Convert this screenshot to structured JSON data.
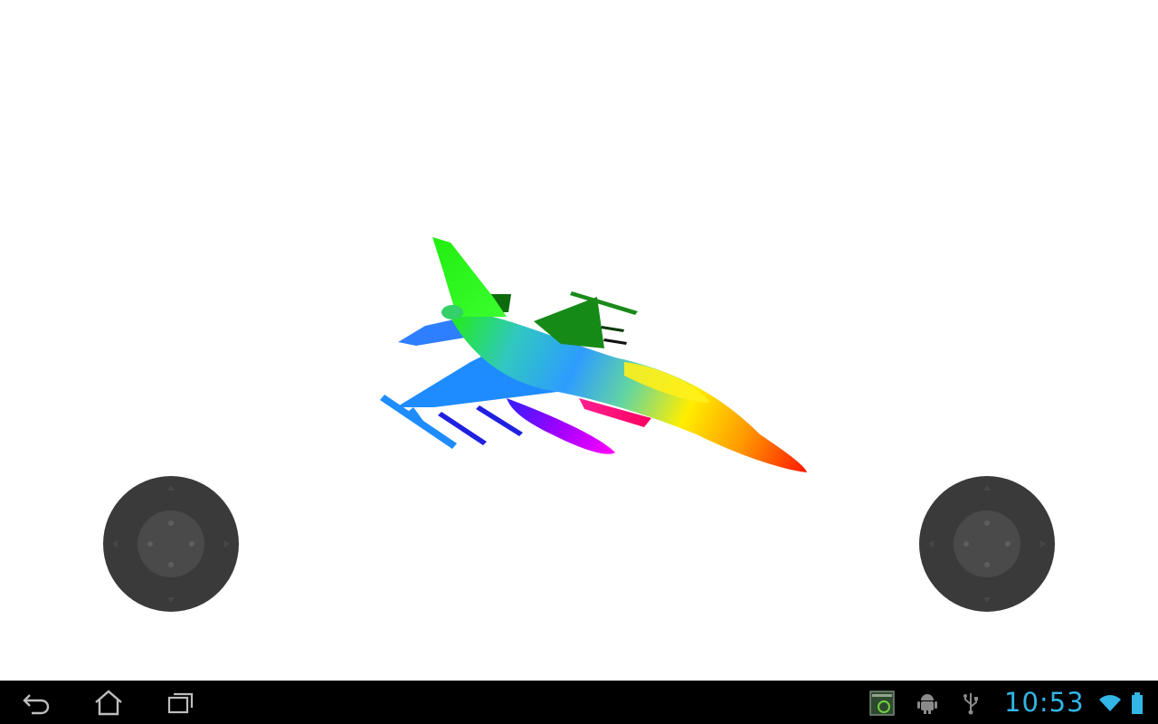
{
  "scene": {
    "subject": "fighter-jet-model",
    "background_color": "#ffffff",
    "colors": {
      "tail": "#22ee11",
      "fuselage_mid": "#28a0ff",
      "nose_yellow": "#ffee00",
      "nose_tip": "#ff2a00",
      "missiles_blue": "#2020e0",
      "tank_magenta": "#ff00ff",
      "wing_dark_green": "#168a16"
    }
  },
  "controls": {
    "left_joystick": {
      "icon": "dpad-joystick-icon",
      "color": "#3a3a3a"
    },
    "right_joystick": {
      "icon": "dpad-joystick-icon",
      "color": "#3a3a3a"
    }
  },
  "system_bar": {
    "buttons": {
      "back": "back-icon",
      "home": "home-icon",
      "recent": "recent-apps-icon"
    },
    "notifications": [
      "screenshot-icon",
      "android-debug-icon",
      "usb-icon"
    ],
    "clock": "10:53",
    "accent_color": "#33b5e5",
    "wifi": "wifi-icon",
    "battery": "battery-icon"
  }
}
